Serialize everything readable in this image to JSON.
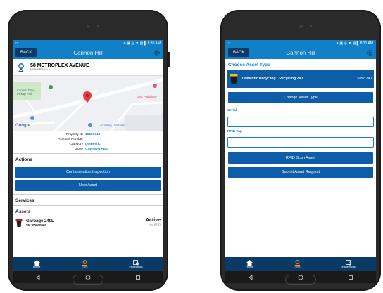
{
  "left": {
    "statusbar": {
      "icons": "✶ ▣ ◎ ▼ ▤ ▌",
      "time": "8:30 AM"
    },
    "header": {
      "back": "BACK",
      "title": "Cannon Hill"
    },
    "address": {
      "line1": "58 METROPLEX AVENUE",
      "line2": "MURARRIE 4172"
    },
    "map": {
      "labels": [
        "Cannon Drive Pickup Park",
        "QML Pathology",
        "4Cabling - Murarrie",
        "Google"
      ]
    },
    "info": [
      {
        "k": "Property ID",
        "v": "10621746"
      },
      {
        "k": "Account Number",
        "v": ""
      },
      {
        "k": "Category",
        "v": "Domestic"
      },
      {
        "k": "Zone",
        "v": "CANNON HILL"
      }
    ],
    "actions": {
      "heading": "Actions",
      "buttons": [
        "Contamination Inspection",
        "New Asset"
      ]
    },
    "services": {
      "heading": "Services"
    },
    "assets": {
      "heading": "Assets",
      "items": [
        {
          "name": "Garbage 240L",
          "sn": "SN: 00000000",
          "status": "Active",
          "rfid": "No RFID"
        }
      ]
    },
    "nav": [
      {
        "label": "Home",
        "active": false
      },
      {
        "label": "Sites",
        "active": true
      },
      {
        "label": "Inspections",
        "active": false
      }
    ]
  },
  "right": {
    "statusbar": {
      "icons": "✶ ▣ ◎ ▼ ▤ ▌",
      "time": "8:31 AM"
    },
    "header": {
      "back": "BACK",
      "title": "Cannon Hill"
    },
    "choose_heading": "Choose Asset Type",
    "selected_type": {
      "category": "Domestic Recycling",
      "name": "Recycling 240L",
      "size": "Size: 240"
    },
    "change_button": "Change Asset Type",
    "serial": {
      "label": "Serial",
      "value": "",
      "placeholder": ""
    },
    "rfid": {
      "label": "RFID Tag",
      "value": "",
      "placeholder": ""
    },
    "rfid_scan_button": "RFID Scan Asset",
    "submit_button": "Submit Asset Request",
    "nav": [
      {
        "label": "Home",
        "active": false
      },
      {
        "label": "Sites",
        "active": true
      },
      {
        "label": "Inspections",
        "active": false
      }
    ]
  },
  "colors": {
    "primary": "#1180c6",
    "button": "#0d5da8",
    "navy": "#0b3a67",
    "accent": "#ff9a3c"
  }
}
